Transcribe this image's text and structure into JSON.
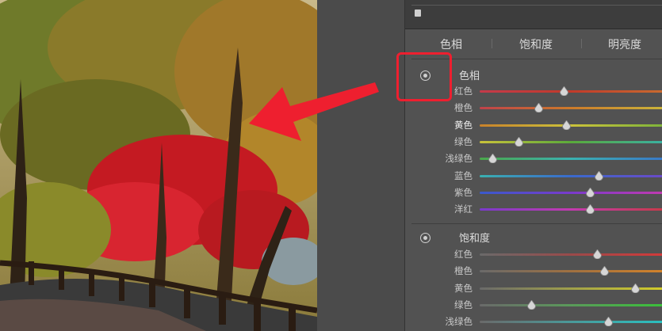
{
  "tabs": [
    "色相",
    "饱和度",
    "明亮度"
  ],
  "sections": {
    "hue": {
      "title": "色相",
      "sliders": [
        {
          "label": "红色",
          "value": 0.46,
          "gradient": [
            "#c43a4a",
            "#c23a2a",
            "#c96a2f"
          ]
        },
        {
          "label": "橙色",
          "value": 0.32,
          "gradient": [
            "#c0424a",
            "#cc7a2a",
            "#cbb43a"
          ]
        },
        {
          "label": "黄色",
          "value": 0.47,
          "gradient": [
            "#c9822b",
            "#cbc23a",
            "#7fb43a"
          ]
        },
        {
          "label": "绿色",
          "value": 0.21,
          "gradient": [
            "#c9c33a",
            "#5aaa3a",
            "#3ab0a0"
          ]
        },
        {
          "label": "浅绿色",
          "value": 0.07,
          "gradient": [
            "#4aa84a",
            "#3ab2b0",
            "#3a7ac8"
          ]
        },
        {
          "label": "蓝色",
          "value": 0.65,
          "gradient": [
            "#3ab0b0",
            "#3a6acc",
            "#6a4ac8"
          ]
        },
        {
          "label": "紫色",
          "value": 0.6,
          "gradient": [
            "#3a5acc",
            "#7a3acc",
            "#c03ab0"
          ]
        },
        {
          "label": "洋红",
          "value": 0.6,
          "gradient": [
            "#7a3acc",
            "#c43ab0",
            "#c83a4a"
          ]
        }
      ]
    },
    "saturation": {
      "title": "饱和度",
      "sliders": [
        {
          "label": "红色",
          "value": 0.64,
          "gradient": [
            "#6a6a6a",
            "#9a4a4a",
            "#d23a3a"
          ]
        },
        {
          "label": "橙色",
          "value": 0.68,
          "gradient": [
            "#6a6a6a",
            "#a07040",
            "#d2822a"
          ]
        },
        {
          "label": "黄色",
          "value": 0.85,
          "gradient": [
            "#6a6a6a",
            "#a0a04a",
            "#d2cc2a"
          ]
        },
        {
          "label": "绿色",
          "value": 0.28,
          "gradient": [
            "#6a6a6a",
            "#5a9a5a",
            "#3ac03a"
          ]
        },
        {
          "label": "浅绿色",
          "value": 0.7,
          "gradient": [
            "#6a6a6a",
            "#4a9a9a",
            "#2ac0c0"
          ]
        }
      ]
    }
  },
  "colors": {
    "annotation": "#ee1f2f",
    "panel_bg": "#525252"
  },
  "icons": [
    "target-adjustment-icon",
    "panel-grip-icon"
  ]
}
